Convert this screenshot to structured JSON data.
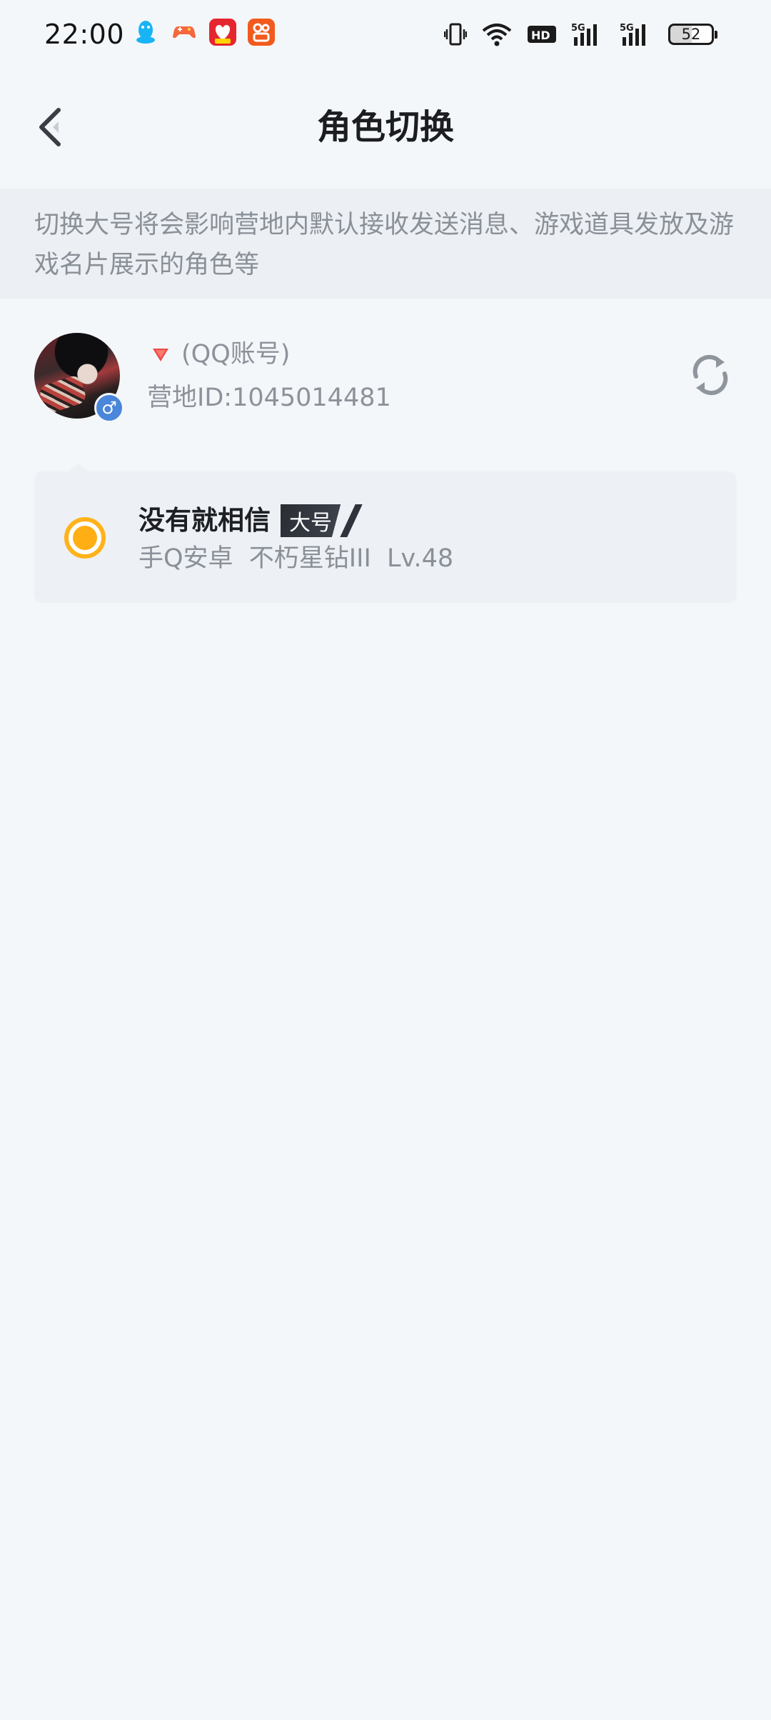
{
  "status_bar": {
    "time": "22:00",
    "battery": "52",
    "notification_icons": [
      "qq-penguin-icon",
      "game-controller-icon",
      "red-app-icon",
      "orange-app-icon"
    ],
    "system_icons": [
      "vibrate-icon",
      "wifi-icon",
      "hd-icon",
      "5g-signal-icon",
      "5g-signal-icon"
    ]
  },
  "nav": {
    "title": "角色切换"
  },
  "notice": {
    "text": "切换大号将会影响营地内默认接收发送消息、游戏道具发放及游戏名片展示的角色等"
  },
  "account": {
    "type_label": "(QQ账号)",
    "camp_id": "营地ID:1045014481",
    "gender_symbol": "♂"
  },
  "role": {
    "name": "没有就相信",
    "tag": "大号",
    "detail": "手Q安卓  不朽星钻III  Lv.48",
    "selected": true
  },
  "colors": {
    "background": "#f4f7fa",
    "notice_bg": "#eceff3",
    "card_bg": "#edf0f4",
    "radio_accent": "#ffaf14",
    "gender_badge": "#4a86d9",
    "tag_bg": "#2a2d34"
  }
}
